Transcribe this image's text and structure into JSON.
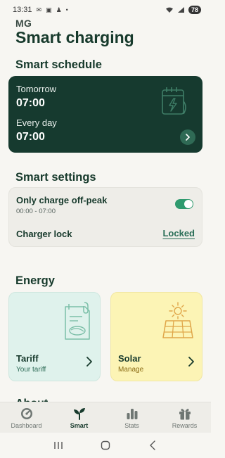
{
  "status_bar": {
    "time": "13:31",
    "battery": "78",
    "icons": [
      "mail-icon",
      "nfc-icon",
      "person-icon",
      "dot-icon",
      "wifi-icon",
      "signal-icon"
    ]
  },
  "header": {
    "brand": "MG",
    "title": "Smart charging"
  },
  "schedule": {
    "section_title": "Smart schedule",
    "rows": [
      {
        "label": "Tomorrow",
        "time": "07:00"
      },
      {
        "label": "Every day",
        "time": "07:00"
      }
    ],
    "icon": "calendar-charge-icon"
  },
  "settings": {
    "section_title": "Smart settings",
    "off_peak": {
      "label": "Only charge off-peak",
      "hours": "00:00 - 07:00",
      "enabled": true
    },
    "charger_lock": {
      "label": "Charger lock",
      "value": "Locked"
    }
  },
  "energy": {
    "section_title": "Energy",
    "tariff": {
      "title": "Tariff",
      "subtitle": "Your tariff",
      "icon": "tariff-document-icon"
    },
    "solar": {
      "title": "Solar",
      "subtitle": "Manage",
      "icon": "solar-panel-icon"
    }
  },
  "about": {
    "section_title": "About"
  },
  "bottom_nav": {
    "items": [
      {
        "label": "Dashboard",
        "icon": "speedometer-icon",
        "active": false
      },
      {
        "label": "Smart",
        "icon": "sprout-icon",
        "active": true
      },
      {
        "label": "Stats",
        "icon": "bar-chart-icon",
        "active": false
      },
      {
        "label": "Rewards",
        "icon": "gift-icon",
        "active": false
      }
    ]
  },
  "colors": {
    "primary_dark": "#163a2f",
    "accent_green": "#2f9a6e",
    "tariff_bg": "#dff2ec",
    "solar_bg": "#fcf4b5",
    "background": "#f7f6f2"
  }
}
